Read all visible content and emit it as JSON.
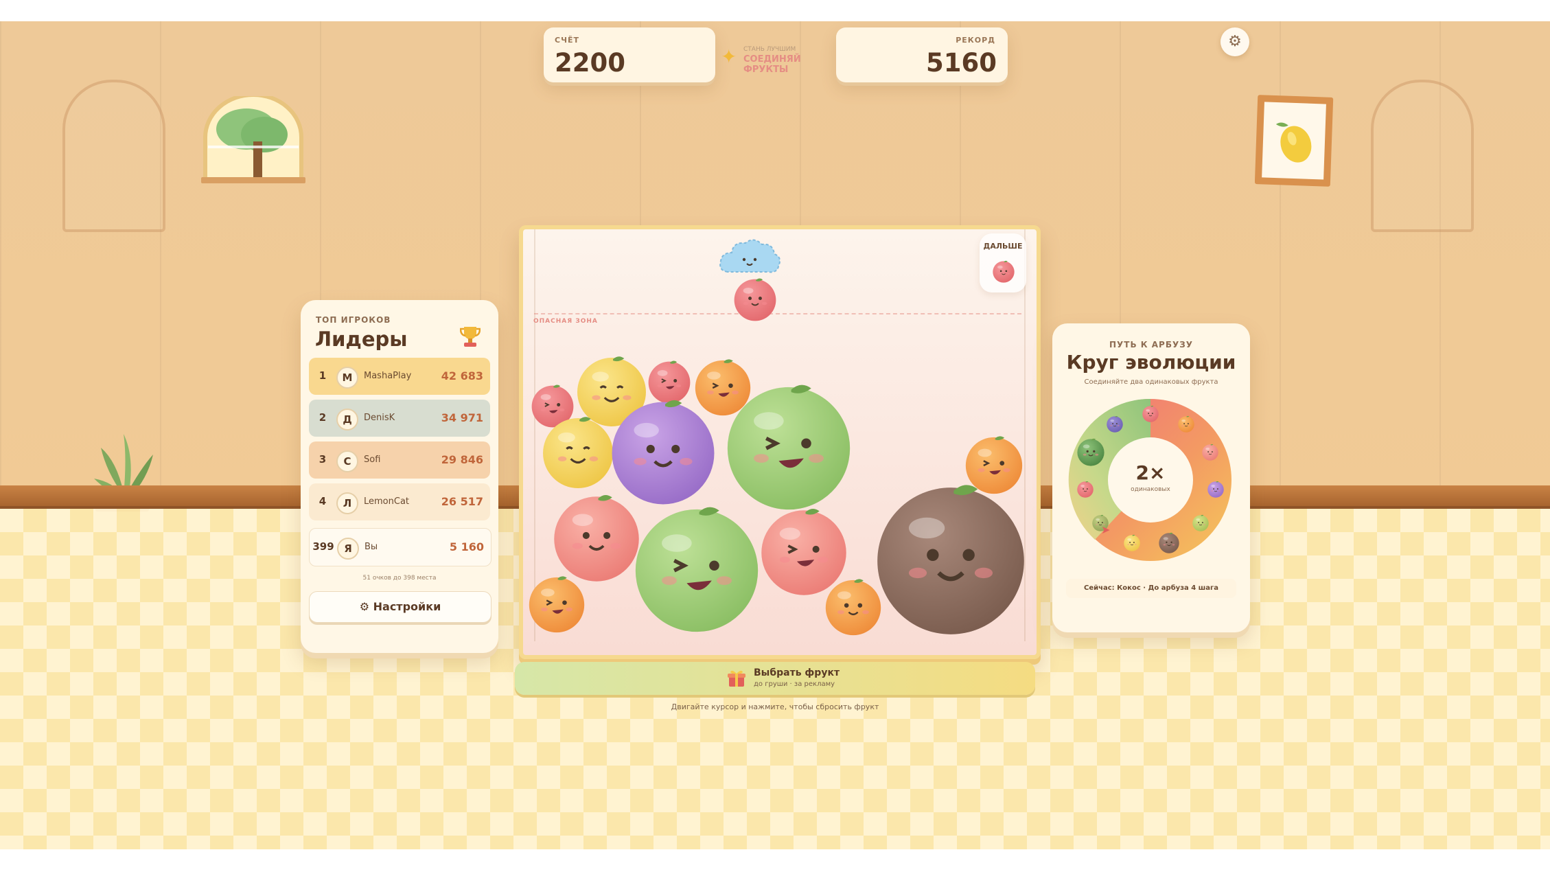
{
  "hud": {
    "score_label": "СЧЁТ",
    "score_value": "2200",
    "tagline_small": "СТАНЬ ЛУЧШИМ",
    "tagline_main": "СОЕДИНЯЙ ФРУКТЫ",
    "record_label": "РЕКОРД",
    "record_value": "5160",
    "settings_icon": "gear-icon"
  },
  "leaderboard": {
    "kicker": "ТОП ИГРОКОВ",
    "title": "Лидеры",
    "trophy_icon": "trophy-icon",
    "rows": [
      {
        "rank": "1",
        "initial": "M",
        "name": "MashaPlay",
        "score": "42 683",
        "color": "#f9d88f"
      },
      {
        "rank": "2",
        "initial": "Д",
        "name": "DenisK",
        "score": "34 971",
        "color": "#d8ddd0"
      },
      {
        "rank": "3",
        "initial": "С",
        "name": "Sofi",
        "score": "29 846",
        "color": "#f6d2ab"
      },
      {
        "rank": "4",
        "initial": "Л",
        "name": "LemonCat",
        "score": "26 517",
        "color": "#fbead0"
      }
    ],
    "me": {
      "rank": "399",
      "initial": "Я",
      "name": "Вы",
      "score": "5 160"
    },
    "gap_note": "51 очков до 398 места",
    "settings_button": "Настройки",
    "settings_button_icon": "⚙"
  },
  "game": {
    "danger_label": "ОПАСНАЯ ЗОНА",
    "next_label": "ДАЛЬШЕ",
    "current_fruit": "cherry",
    "next_fruit": "cherry"
  },
  "pick_fruit": {
    "title": "Выбрать фрукт",
    "subtitle": "до груши · за рекламу",
    "icon": "gift-icon"
  },
  "hint": "Двигайте курсор и нажмите, чтобы сбросить фрукт",
  "evolution": {
    "kicker": "ПУТЬ К АРБУЗУ",
    "title": "Круг эволюции",
    "subtitle": "Соединяйте два одинаковых фрукта",
    "center_value": "2×",
    "center_label": "одинаковых",
    "status": "Сейчас: Кокос · До арбуза 4 шага"
  }
}
